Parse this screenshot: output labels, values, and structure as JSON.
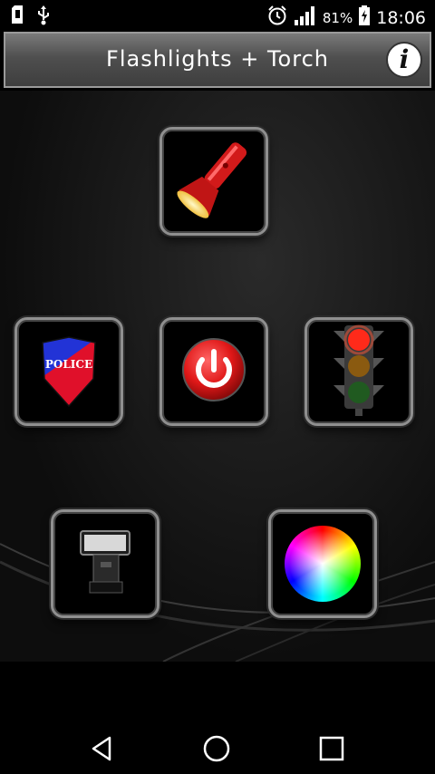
{
  "status_bar": {
    "icons_left": [
      "sd-card-icon",
      "usb-icon"
    ],
    "alarm_icon": "alarm-clock-icon",
    "signal_icon": "signal-bars-icon",
    "battery_percent": "81%",
    "battery_icon": "battery-charging-icon",
    "time": "18:06"
  },
  "header": {
    "title": "Flashlights + Torch",
    "info_icon": "info-icon",
    "info_glyph": "i"
  },
  "tiles": {
    "flashlight": {
      "icon": "flashlight-icon"
    },
    "police": {
      "icon": "police-badge-icon",
      "label": "POLICE"
    },
    "power": {
      "icon": "power-icon"
    },
    "traffic_light": {
      "icon": "traffic-light-icon"
    },
    "camera_flash": {
      "icon": "camera-flash-icon"
    },
    "color_wheel": {
      "icon": "color-wheel-icon"
    }
  },
  "navigation": {
    "back": "back-icon",
    "home": "home-icon",
    "recents": "recents-icon"
  },
  "colors": {
    "background": "#000000",
    "accent_red": "#e21c1c",
    "title_bar": "#4f4f4f"
  }
}
